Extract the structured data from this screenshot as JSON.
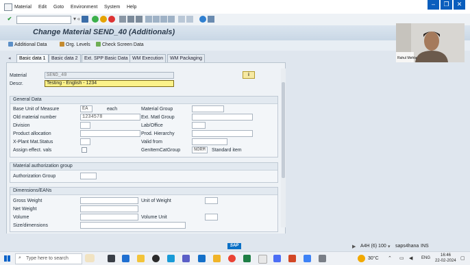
{
  "menubar": {
    "items": [
      "Material",
      "Edit",
      "Goto",
      "Environment",
      "System",
      "Help"
    ]
  },
  "window_controls": {
    "minimize": "–",
    "restore": "❐",
    "close": "✕"
  },
  "title": "Change Material SEND_40 (Additionals)",
  "app_toolbar": {
    "additional_data": "Additional Data",
    "org_levels": "Org. Levels",
    "check_screen_data": "Check Screen Data"
  },
  "tabs": [
    "Basic data 1",
    "Basic data 2",
    "Ext. SPP Basic Data",
    "WM Execution",
    "WM Packaging"
  ],
  "header": {
    "material_label": "Material",
    "material_value": "SEND_40",
    "descr_label": "Descr.",
    "descr_value": "Testing - English - 1234",
    "info_icon": "i"
  },
  "general_data": {
    "title": "General Data",
    "base_uom_label": "Base Unit of Measure",
    "base_uom_value": "EA",
    "base_uom_text": "each",
    "old_material_label": "Old material number",
    "old_material_value": "1234578",
    "division_label": "Division",
    "product_allocation_label": "Product allocation",
    "xplant_status_label": "X-Plant Mat.Status",
    "assign_effect_label": "Assign effect. vals",
    "material_group_label": "Material Group",
    "ext_matl_group_label": "Ext. Matl Group",
    "lab_office_label": "Lab/Office",
    "prod_hierarchy_label": "Prod. Hierarchy",
    "valid_from_label": "Valid from",
    "gen_item_cat_label": "GenItemCatGroup",
    "gen_item_cat_value": "NORM",
    "gen_item_cat_text": "Standard item"
  },
  "material_auth": {
    "title": "Material authorization group",
    "auth_group_label": "Authorization Group"
  },
  "dimensions": {
    "title": "Dimensions/EANs",
    "gross_weight_label": "Gross Weight",
    "weight_unit_label": "Unit of Weight",
    "net_weight_label": "Net Weight",
    "volume_label": "Volume",
    "volume_unit_label": "Volume Unit",
    "size_dimensions_label": "Size/dimensions"
  },
  "status": {
    "sap_logo": "SAP",
    "system": "A4H (6) 100",
    "server": "saps4hana",
    "mode": "INS"
  },
  "webcam": {
    "name": "Rahul Mehta"
  },
  "taskbar": {
    "search_placeholder": "Type here to search",
    "temperature": "30°C",
    "language": "ENG",
    "time": "16:46",
    "date": "22-02-2024"
  },
  "colors": {
    "accent": "#0a5ebd",
    "descr_highlight": "#fbf28a",
    "title": "#2a3a4c"
  }
}
